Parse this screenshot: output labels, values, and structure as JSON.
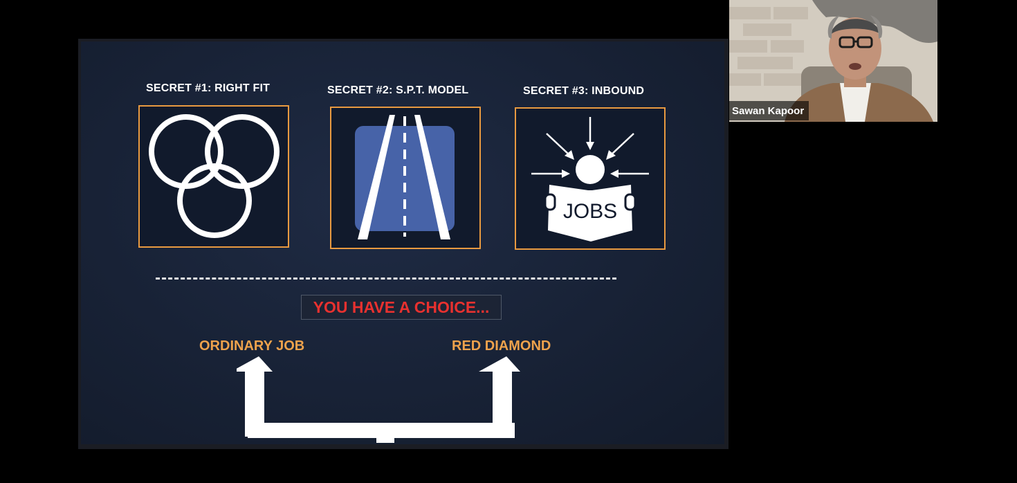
{
  "slide": {
    "secrets": [
      {
        "title": "SECRET #1: RIGHT FIT",
        "icon": "three-rings-icon"
      },
      {
        "title": "SECRET #2: S.P.T. MODEL",
        "icon": "road-icon"
      },
      {
        "title": "SECRET #3: INBOUND",
        "icon": "person-reading-jobs-icon",
        "icon_text": "JOBS"
      }
    ],
    "choice_text": "YOU HAVE A CHOICE...",
    "options": {
      "left": "ORDINARY JOB",
      "right": "RED DIAMOND"
    },
    "fork_icon": "fork-arrows-icon"
  },
  "participant": {
    "name": "Sawan Kapoor"
  },
  "colors": {
    "slide_background": "#182236",
    "box_border": "#e99a40",
    "choice_text": "#e8312f",
    "option_text": "#eea24c"
  }
}
